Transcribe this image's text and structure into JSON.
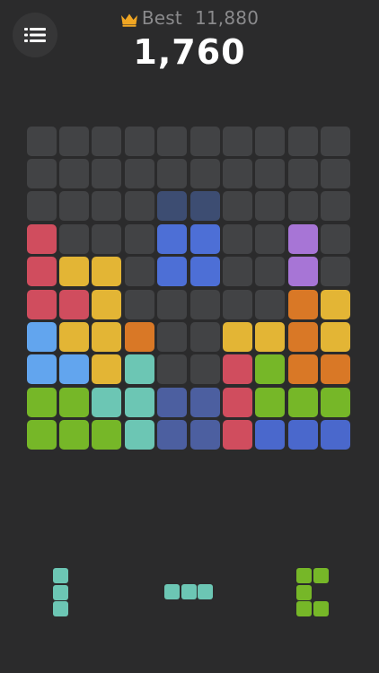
{
  "header": {
    "best_label": "Best",
    "best_value": "11,880",
    "score": "1,760",
    "crown_color": "#f0a623"
  },
  "menu": {
    "icon": "menu-list-icon"
  },
  "palette": {
    ".": "#424345",
    "R": "#d04d5e",
    "Y": "#e3b535",
    "O": "#d97826",
    "B": "#62a5ee",
    "T": "#6cc6b4",
    "G": "#76b728",
    "P": "#a775d6",
    "N": "#4a68cc",
    "S": "#4c5fa0",
    "H": "#4d6fd6",
    "U": "#3d4d72"
  },
  "board": {
    "size": 10,
    "rows": [
      "..........",
      "..........",
      "....UU....",
      "R...HH..P.",
      "RYY.HH..P.",
      "RRY.....OY",
      "BYYO..YYOY",
      "BBYT..RGOO",
      "GGTTSSRGGG",
      "GGGTSSRNNN"
    ]
  },
  "pieces": [
    {
      "name": "vertical-3",
      "color": "#6cc6b4",
      "cells": [
        [
          0,
          0
        ],
        [
          0,
          1
        ],
        [
          0,
          2
        ]
      ]
    },
    {
      "name": "horizontal-3",
      "color": "#6cc6b4",
      "cells": [
        [
          0,
          0
        ],
        [
          1,
          0
        ],
        [
          2,
          0
        ]
      ]
    },
    {
      "name": "c-shape",
      "color": "#76b728",
      "cells": [
        [
          0,
          0
        ],
        [
          1,
          0
        ],
        [
          0,
          1
        ],
        [
          0,
          2
        ],
        [
          1,
          2
        ]
      ]
    }
  ]
}
